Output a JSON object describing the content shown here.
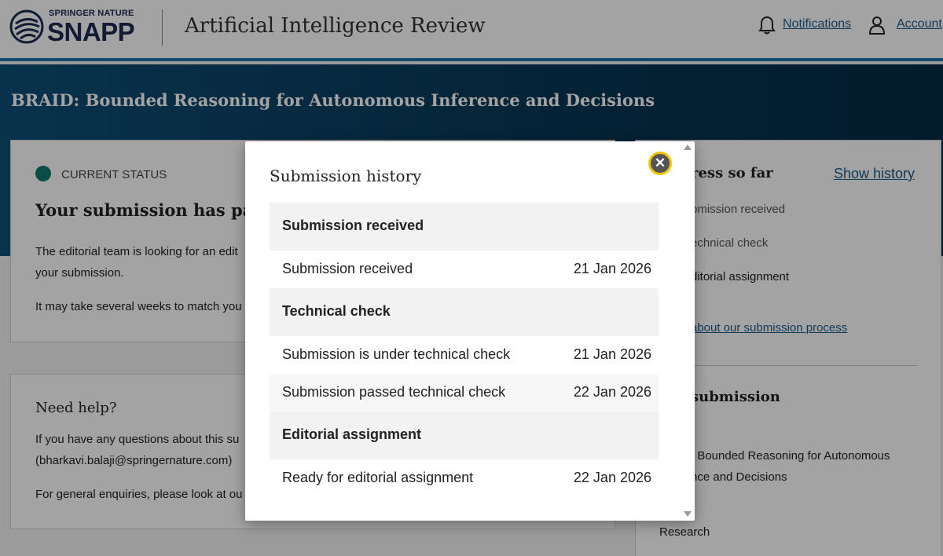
{
  "header": {
    "brand_top": "SPRINGER NATURE",
    "brand_main": "SNAPP",
    "journal_title": "Artificial Intelligence Review",
    "notifications_label": "Notifications",
    "account_label": "Account",
    "icons": [
      "bell-icon",
      "person-icon"
    ]
  },
  "manuscript": {
    "title": "BRAID: Bounded Reasoning for Autonomous Inference and Decisions"
  },
  "status_card": {
    "status_label": "CURRENT STATUS",
    "heading": "Your submission has passe",
    "para1_line1": "The editorial team is looking for an edit",
    "para1_line2": "your submission.",
    "para2": "It may take several weeks to match you",
    "status_color": "#0d7a6e"
  },
  "help_card": {
    "heading": "Need help?",
    "line1": "If you have any questions about this su",
    "line2": "(bharkavi.balaji@springernature.com)",
    "line3": "For general enquiries, please look at ou"
  },
  "progress_card": {
    "heading": "ress so far",
    "show_history_label": "Show history",
    "steps": [
      "bmission received",
      "echnical check",
      "ditorial assignment"
    ],
    "about_link": "about our submission process",
    "submission_heading": "submission",
    "title_line1": ": Bounded Reasoning for Autonomous",
    "title_line2": "nce and Decisions",
    "article_type": "Research"
  },
  "modal": {
    "title": "Submission history",
    "close_icon": "close-icon",
    "sections": [
      {
        "label": "Submission received",
        "events": [
          {
            "label": "Submission received",
            "date": "21 Jan 2026"
          }
        ]
      },
      {
        "label": "Technical check",
        "events": [
          {
            "label": "Submission is under technical check",
            "date": "21 Jan 2026"
          },
          {
            "label": "Submission passed technical check",
            "date": "22 Jan 2026"
          }
        ]
      },
      {
        "label": "Editorial assignment",
        "events": [
          {
            "label": "Ready for editorial assignment",
            "date": "22 Jan 2026"
          }
        ]
      }
    ]
  },
  "colors": {
    "accent_blue": "#1b76a8",
    "link_blue": "#1b5c8c",
    "banner_dark": "#083958",
    "focus_yellow": "#f0c400"
  }
}
